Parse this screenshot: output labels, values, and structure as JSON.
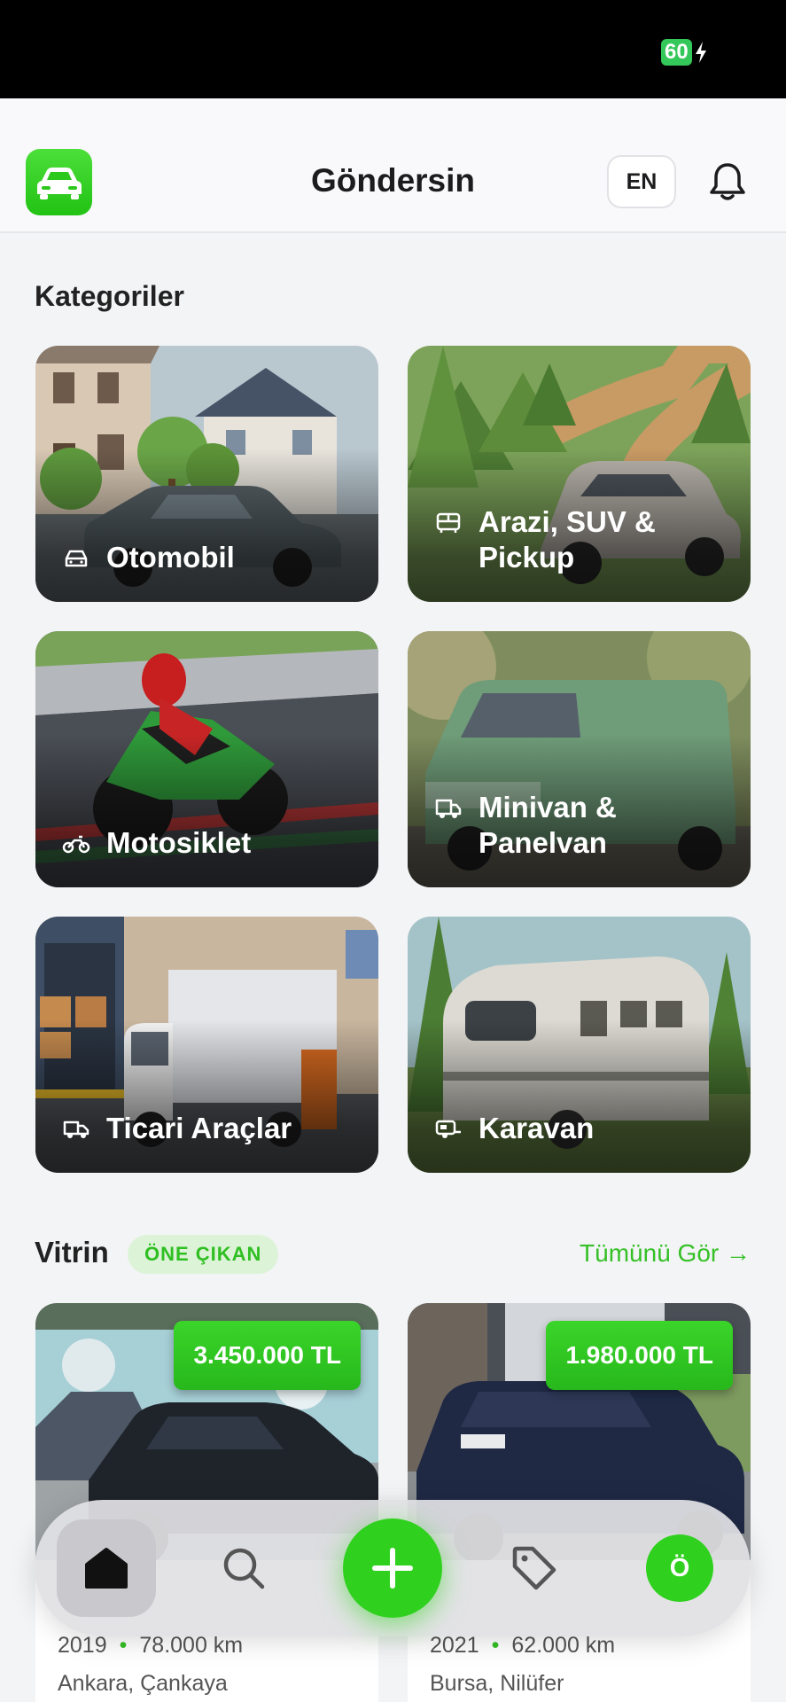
{
  "status_bar": {
    "battery": "60"
  },
  "header": {
    "title": "Göndersin",
    "lang_button": "EN",
    "logo_icon": "car-icon",
    "bell_icon": "bell-icon"
  },
  "categories": {
    "title": "Kategoriler",
    "items": [
      {
        "label": "Otomobil",
        "icon": "car-icon"
      },
      {
        "label": "Arazi, SUV & Pickup",
        "icon": "bus-icon"
      },
      {
        "label": "Motosiklet",
        "icon": "motorcycle-icon"
      },
      {
        "label": "Minivan & Panelvan",
        "icon": "van-icon"
      },
      {
        "label": "Ticari Araçlar",
        "icon": "truck-icon"
      },
      {
        "label": "Karavan",
        "icon": "caravan-icon"
      }
    ]
  },
  "vitrin": {
    "title": "Vitrin",
    "badge": "ÖNE ÇIKAN",
    "see_all": "Tümünü Gör →",
    "listings": [
      {
        "price": "3.450.000 TL",
        "year": "2019",
        "km": "78.000 km",
        "location": "Ankara, Çankaya"
      },
      {
        "price": "1.980.000 TL",
        "year": "2021",
        "km": "62.000 km",
        "location": "Bursa, Nilüfer"
      }
    ]
  },
  "bottom_nav": {
    "items": [
      "home-icon",
      "search-icon",
      "plus-icon",
      "tag-icon"
    ],
    "avatar_initial": "Ö",
    "colors": {
      "accent": "#2fd11e"
    }
  }
}
